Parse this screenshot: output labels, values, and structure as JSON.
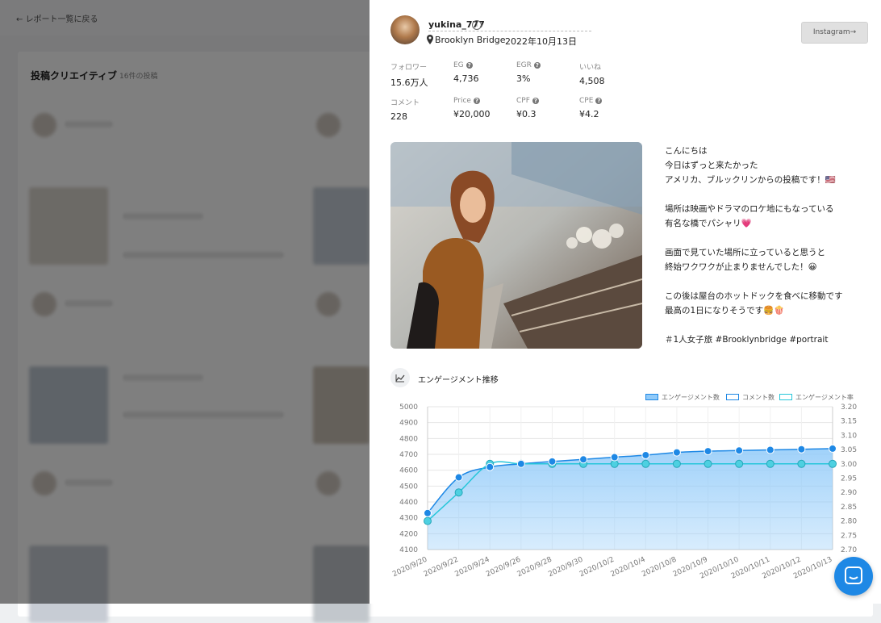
{
  "background": {
    "back_label": "レポート一覧に戻る",
    "section_title": "投稿クリエイティブ",
    "section_count": "16件の投稿"
  },
  "post": {
    "username": "yukina_777",
    "location": "Brooklyn Bridge",
    "date": "2022年10月13日",
    "instagram_button": "Instagram→",
    "stats": [
      {
        "label": "フォロワー",
        "value": "15.6万人",
        "help": false
      },
      {
        "label": "EG",
        "value": "4,736",
        "help": true
      },
      {
        "label": "EGR",
        "value": "3%",
        "help": true
      },
      {
        "label": "いいね",
        "value": "4,508",
        "help": false
      },
      {
        "label": "コメント",
        "value": "228",
        "help": false
      },
      {
        "label": "Price",
        "value": "¥20,000",
        "help": true
      },
      {
        "label": "CPF",
        "value": "¥0.3",
        "help": true
      },
      {
        "label": "CPE",
        "value": "¥4.2",
        "help": true
      }
    ],
    "caption_lines": [
      "こんにちは",
      "今日はずっと来たかった",
      "アメリカ、ブルックリンからの投稿です！🇺🇸",
      "",
      "場所は映画やドラマのロケ地にもなっている",
      "有名な橋でパシャリ💗",
      "",
      "画面で見ていた場所に立っていると思うと",
      "終始ワクワクが止まりませんでした！😀",
      "",
      "この後は屋台のホットドックを食べに移動です",
      "最高の1日になりそうです🍔🍿",
      "",
      "＃1人女子旅 #Brooklynbridge #portrait"
    ]
  },
  "engagement": {
    "title": "エンゲージメント推移",
    "legend": [
      "エンゲージメント数",
      "コメント数",
      "エンゲージメント率"
    ]
  },
  "colors": {
    "engagement": "#1e88e5",
    "comment": "#1e88e5",
    "rate": "#26c6da",
    "area_fill": "#90caf9"
  },
  "chart_data": {
    "type": "line",
    "x": [
      "2020/9/20",
      "2020/9/22",
      "2020/9/24",
      "2020/9/26",
      "2020/9/28",
      "2020/9/30",
      "2020/10/2",
      "2020/10/4",
      "2020/10/8",
      "2020/10/9",
      "2020/10/10",
      "2020/10/11",
      "2020/10/12",
      "2020/10/13"
    ],
    "series": [
      {
        "name": "エンゲージメント数",
        "axis": "left",
        "fill": true,
        "values": [
          4330,
          4555,
          4620,
          4640,
          4655,
          4668,
          4682,
          4695,
          4712,
          4720,
          4724,
          4728,
          4732,
          4736
        ]
      },
      {
        "name": "エンゲージメント率",
        "axis": "right",
        "fill": false,
        "values": [
          2.8,
          2.9,
          3.0,
          3.0,
          3.0,
          3.0,
          3.0,
          3.0,
          3.0,
          3.0,
          3.0,
          3.0,
          3.0,
          3.0
        ]
      }
    ],
    "ylim_left": [
      4100,
      5000
    ],
    "yticks_left": [
      4100,
      4200,
      4300,
      4400,
      4500,
      4600,
      4700,
      4800,
      4900,
      5000
    ],
    "ylim_right": [
      2.7,
      3.2
    ],
    "yticks_right": [
      "2.70",
      "2.75",
      "2.80",
      "2.85",
      "2.90",
      "2.95",
      "3.00",
      "3.05",
      "3.10",
      "3.15",
      "3.20"
    ],
    "grid": true,
    "legend_position": "top-right"
  }
}
